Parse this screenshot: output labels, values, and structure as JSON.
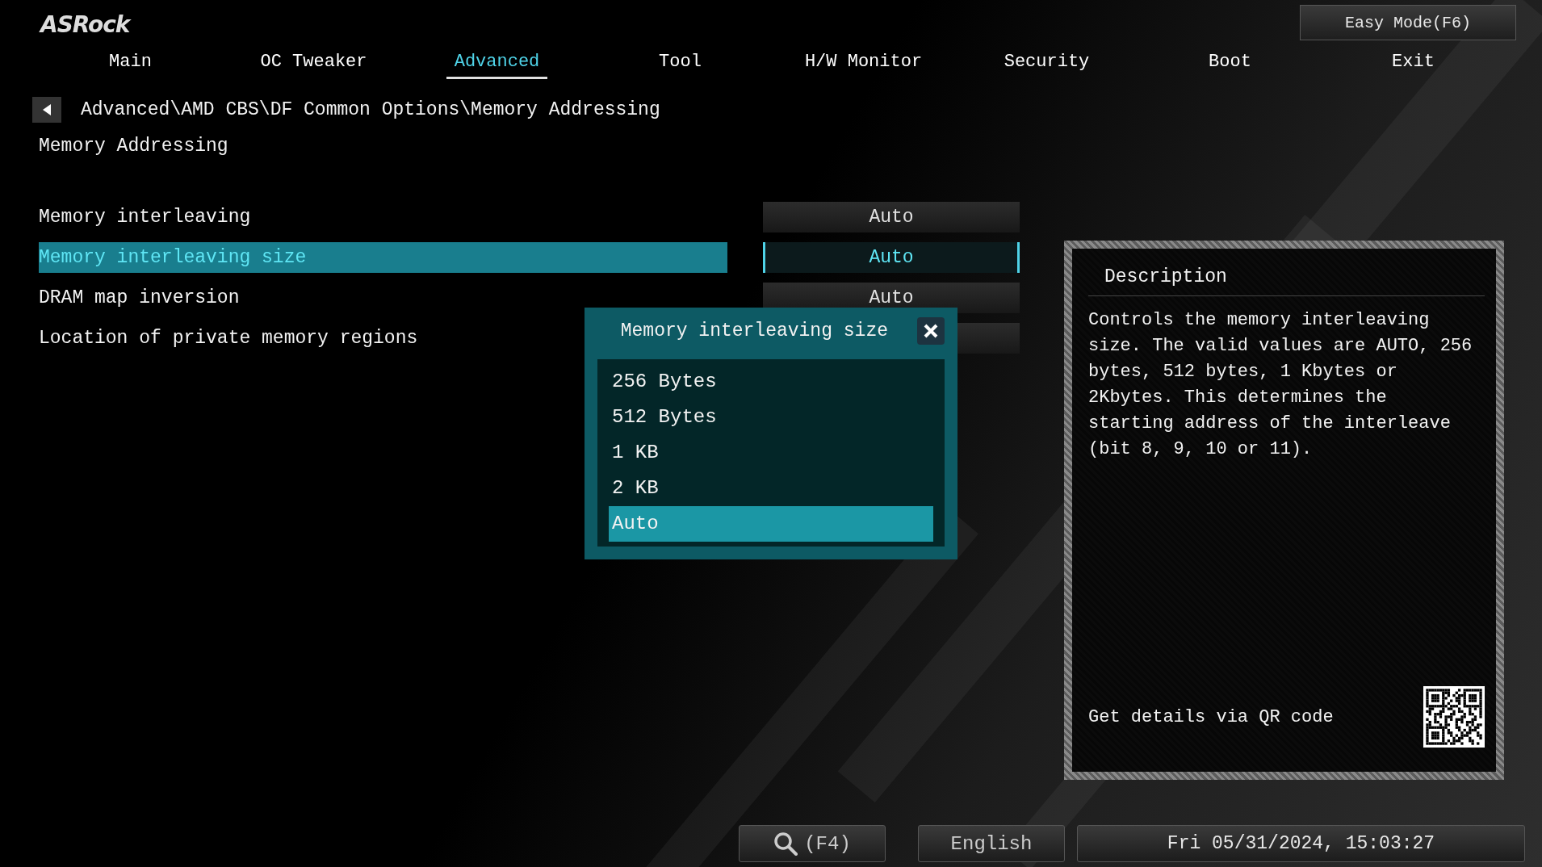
{
  "logo": "ASRock",
  "easy_mode_button": "Easy Mode(F6)",
  "tabs": [
    {
      "label": "Main",
      "selected": false
    },
    {
      "label": "OC Tweaker",
      "selected": false
    },
    {
      "label": "Advanced",
      "selected": true
    },
    {
      "label": "Tool",
      "selected": false
    },
    {
      "label": "H/W Monitor",
      "selected": false
    },
    {
      "label": "Security",
      "selected": false
    },
    {
      "label": "Boot",
      "selected": false
    },
    {
      "label": "Exit",
      "selected": false
    }
  ],
  "breadcrumb": "Advanced\\AMD CBS\\DF Common Options\\Memory Addressing",
  "page_title": "Memory Addressing",
  "settings": [
    {
      "label": "Memory interleaving",
      "value": "Auto",
      "selected": false
    },
    {
      "label": "Memory interleaving size",
      "value": "Auto",
      "selected": true
    },
    {
      "label": "DRAM map inversion",
      "value": "Auto",
      "selected": false
    },
    {
      "label": "Location of private memory regions",
      "selected": false
    }
  ],
  "popup": {
    "title": "Memory interleaving size",
    "options": [
      {
        "label": "256 Bytes",
        "selected": false
      },
      {
        "label": "512 Bytes",
        "selected": false
      },
      {
        "label": "1 KB",
        "selected": false
      },
      {
        "label": "2 KB",
        "selected": false
      },
      {
        "label": "Auto",
        "selected": true
      }
    ]
  },
  "description": {
    "title": "Description",
    "text": "Controls the memory interleaving size. The valid values are AUTO, 256 bytes, 512 bytes, 1 Kbytes or 2Kbytes. This determines the starting address of the interleave (bit 8, 9, 10 or 11).",
    "qr_label": "Get details via QR code"
  },
  "status_bar": {
    "search_key": "(F4)",
    "language": "English",
    "datetime": "Fri 05/31/2024, 15:03:27"
  }
}
